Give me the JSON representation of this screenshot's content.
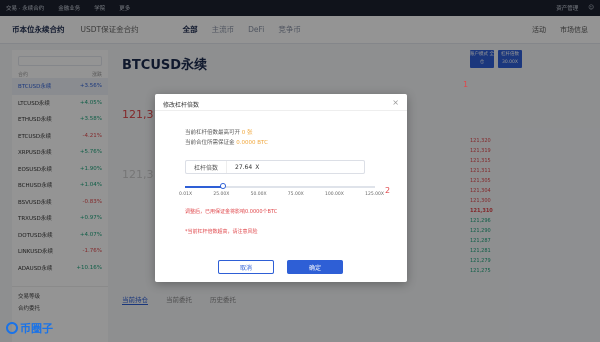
{
  "topbar": {
    "items": [
      "交易 · 永续合约",
      "金融业务",
      "学院",
      "更多"
    ],
    "right": "资产管理"
  },
  "subnav": {
    "tabs": [
      "币本位永续合约",
      "USDT保证金合约"
    ],
    "cats": [
      "全部",
      "主流币",
      "DeFi",
      "竞争币"
    ],
    "tools": [
      "活动",
      "市场信息"
    ]
  },
  "market": {
    "header_left": "合约",
    "header_right": "涨跌",
    "rows": [
      {
        "name": "BTCUSD永续",
        "chg": "+3.56%",
        "color": "blue"
      },
      {
        "name": "LTCUSD永续",
        "chg": "+4.05%",
        "color": "green"
      },
      {
        "name": "ETHUSD永续",
        "chg": "+3.58%",
        "color": "green"
      },
      {
        "name": "ETCUSD永续",
        "chg": "-4.21%",
        "color": "red"
      },
      {
        "name": "XRPUSD永续",
        "chg": "+5.76%",
        "color": "green"
      },
      {
        "name": "EOSUSD永续",
        "chg": "+1.90%",
        "color": "green"
      },
      {
        "name": "BCHUSD永续",
        "chg": "+1.04%",
        "color": "green"
      },
      {
        "name": "BSVUSD永续",
        "chg": "-0.83%",
        "color": "red"
      },
      {
        "name": "TRXUSD永续",
        "chg": "+0.97%",
        "color": "green"
      },
      {
        "name": "DOTUSD永续",
        "chg": "+4.07%",
        "color": "green"
      },
      {
        "name": "LINKUSD永续",
        "chg": "-1.76%",
        "color": "red"
      },
      {
        "name": "ADAUSD永续",
        "chg": "+10.16%",
        "color": "green"
      }
    ],
    "bottom": [
      "交易等级",
      "合约委托"
    ]
  },
  "center": {
    "symbol": "BTCUSD永续",
    "price_top": "121,3",
    "price_mid": "121,3",
    "bottom_tabs": [
      "当前持仓",
      "当前委托",
      "历史委托"
    ]
  },
  "side": {
    "btn1": "账户模式 全仓",
    "btn2": "杠杆倍数 30.00X",
    "orderbook": [
      "121,320",
      "121,319",
      "121,315",
      "121,311",
      "121,305",
      "121,304",
      "121,300",
      "121,310",
      "121,296",
      "121,290",
      "121,287",
      "121,281",
      "121,279",
      "121,275"
    ]
  },
  "modal": {
    "title": "修改杠杆倍数",
    "close": "×",
    "line1_prefix": "当前杠杆倍数最高可开",
    "line1_value": "0 张",
    "line2_prefix": "当前合位所需保证金",
    "line2_value": "0.0000 BTC",
    "lev_label": "杠杆倍数",
    "lev_value": "27.64",
    "lev_unit": "X",
    "slider_fraction": 0.2,
    "ticks": [
      "0.01X",
      "25.00X",
      "50.00X",
      "75.00X",
      "100.00X",
      "125.00X"
    ],
    "warn1": "调整后，已用保证金将影响0.0000个BTC",
    "warn2": "*当前杠杆倍数超高，请注意风险",
    "cancel": "取消",
    "ok": "确定",
    "marker1": "1",
    "marker2": "2"
  },
  "watermark": "币圈子"
}
